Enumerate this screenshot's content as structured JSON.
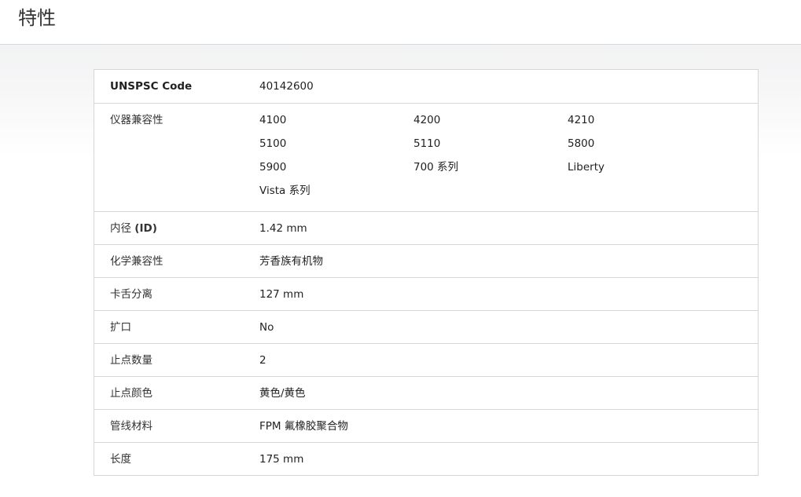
{
  "page": {
    "title": "特性"
  },
  "specs": {
    "unspsc": {
      "label": "UNSPSC Code",
      "value": "40142600"
    },
    "instrument_compat": {
      "label": "仪器兼容性",
      "values": [
        "4100",
        "4200",
        "4210",
        "5100",
        "5110",
        "5800",
        "5900",
        "700 系列",
        "Liberty",
        "Vista 系列"
      ]
    },
    "inner_diameter": {
      "label_prefix": "内径 ",
      "label_bold": "(ID)",
      "value": "1.42 mm"
    },
    "chemical_compat": {
      "label": "化学兼容性",
      "value": "芳香族有机物"
    },
    "clamp_distance": {
      "label": "卡舌分离",
      "value": "127 mm"
    },
    "flared": {
      "label": "扩口",
      "value": "No"
    },
    "stop_count": {
      "label": "止点数量",
      "value": "2"
    },
    "stop_color": {
      "label": "止点颜色",
      "value": "黄色/黄色"
    },
    "tubing_material": {
      "label": "管线材料",
      "value": "FPM 氟橡胶聚合物"
    },
    "length": {
      "label": "长度",
      "value": "175 mm"
    }
  }
}
